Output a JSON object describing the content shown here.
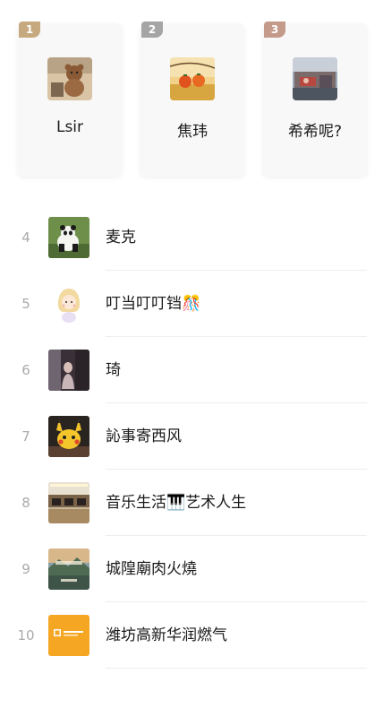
{
  "podium": [
    {
      "rank": "1",
      "name": "Lsir",
      "avatar_icon": "bear-toy-photo-icon"
    },
    {
      "rank": "2",
      "name": "焦玮",
      "avatar_icon": "persimmon-field-photo-icon"
    },
    {
      "rank": "3",
      "name": "希希呢?",
      "avatar_icon": "street-scene-photo-icon"
    }
  ],
  "list": [
    {
      "rank": "4",
      "name": "麦克",
      "avatar_icon": "panda-photo-icon"
    },
    {
      "rank": "5",
      "name": "叮当叮叮铛🎊",
      "avatar_icon": "cartoon-girl-icon"
    },
    {
      "rank": "6",
      "name": "琦",
      "avatar_icon": "portrait-photo-icon"
    },
    {
      "rank": "7",
      "name": "訫事寄西风",
      "avatar_icon": "pikachu-icon"
    },
    {
      "rank": "8",
      "name": "音乐生活🎹艺术人生",
      "avatar_icon": "piano-room-photo-icon"
    },
    {
      "rank": "9",
      "name": "城隍廟肉火燒",
      "avatar_icon": "landscape-poster-icon"
    },
    {
      "rank": "10",
      "name": "潍坊高新华润燃气",
      "avatar_icon": "gas-company-logo-icon"
    }
  ],
  "colors": {
    "gold_badge": "#c7a980",
    "silver_badge": "#a5a5a5",
    "bronze_badge": "#c49b8a",
    "gas_logo_orange": "#f5a623"
  }
}
